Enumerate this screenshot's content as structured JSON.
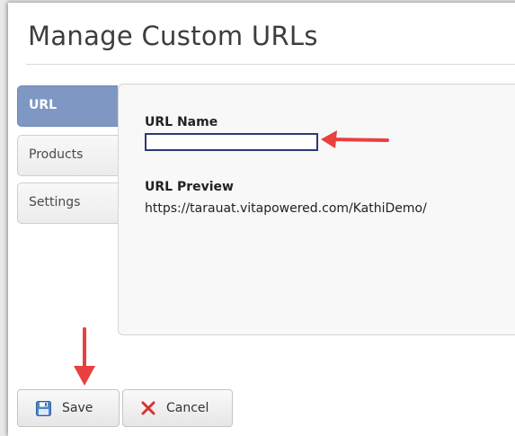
{
  "dialog": {
    "title": "Manage Custom URLs"
  },
  "tabs": [
    {
      "label": "URL",
      "active": true
    },
    {
      "label": "Products",
      "active": false
    },
    {
      "label": "Settings",
      "active": false
    }
  ],
  "form": {
    "url_name_label": "URL Name",
    "url_name_value": "",
    "url_preview_label": "URL Preview",
    "url_preview_value": "https://tarauat.vitapowered.com/KathiDemo/"
  },
  "buttons": {
    "save_label": "Save",
    "save_icon": "floppy-disk-icon",
    "cancel_label": "Cancel",
    "cancel_icon": "close-x-icon"
  },
  "annotations": {
    "arrow_color": "#e8403f"
  },
  "colors": {
    "active_tab": "#7f97c3",
    "input_border": "#2b3a73"
  }
}
